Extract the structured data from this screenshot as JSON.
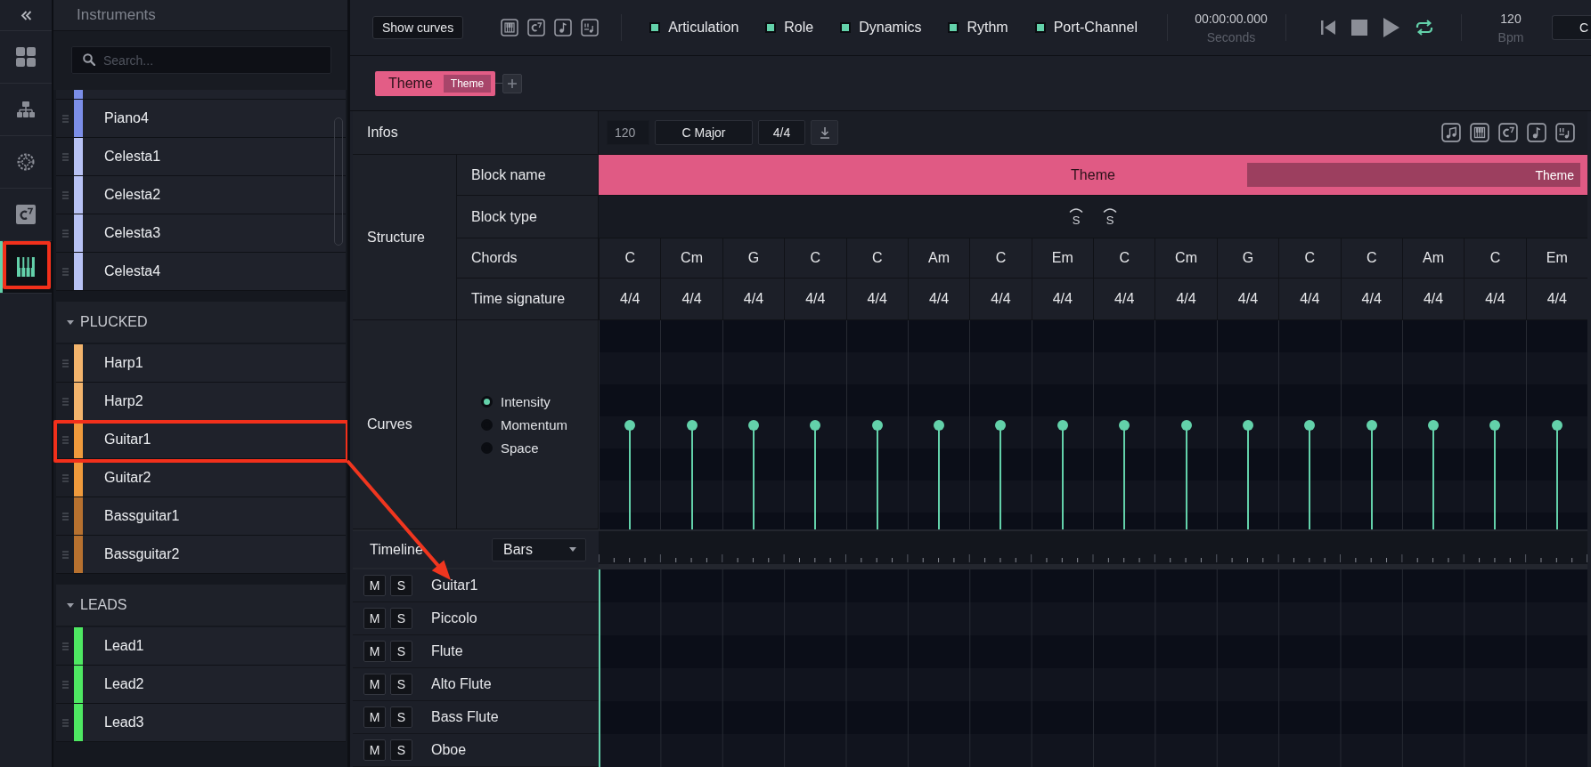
{
  "rail": {
    "items": [
      {
        "kind": "grid",
        "selected": false,
        "annotated": false
      },
      {
        "kind": "hierarchy",
        "selected": false,
        "annotated": false
      },
      {
        "kind": "wheel",
        "selected": false,
        "annotated": false
      },
      {
        "kind": "chord",
        "selected": false,
        "annotated": false
      },
      {
        "kind": "piano",
        "selected": true,
        "annotated": true
      }
    ]
  },
  "instruments": {
    "title": "Instruments",
    "search": {
      "placeholder": "Search..."
    },
    "groups": [
      {
        "items": [
          {
            "kind": "clipped",
            "color": "#7b8ee8",
            "annotated": false
          },
          {
            "kind": "row",
            "name": "Piano4",
            "color": "#7b8ee8",
            "annotated": false
          },
          {
            "kind": "row",
            "name": "Celesta1",
            "color": "#b8c2f4",
            "annotated": false
          },
          {
            "kind": "row",
            "name": "Celesta2",
            "color": "#b8c2f4",
            "annotated": false
          },
          {
            "kind": "row",
            "name": "Celesta3",
            "color": "#b8c2f4",
            "annotated": false
          },
          {
            "kind": "row",
            "name": "Celesta4",
            "color": "#b8c2f4",
            "annotated": false
          }
        ]
      },
      {
        "name": "PLUCKED",
        "expanded": true,
        "items": [
          {
            "kind": "row",
            "name": "Harp1",
            "color": "#f3b46c",
            "annotated": false
          },
          {
            "kind": "row",
            "name": "Harp2",
            "color": "#f3b46c",
            "annotated": false
          },
          {
            "kind": "row",
            "name": "Guitar1",
            "color": "#ef9a3c",
            "annotated": true
          },
          {
            "kind": "row",
            "name": "Guitar2",
            "color": "#ef9a3c",
            "annotated": false
          },
          {
            "kind": "row",
            "name": "Bassguitar1",
            "color": "#b7712f",
            "annotated": false
          },
          {
            "kind": "row",
            "name": "Bassguitar2",
            "color": "#b7712f",
            "annotated": false
          }
        ]
      },
      {
        "name": "LEADS",
        "expanded": true,
        "items": [
          {
            "kind": "row",
            "name": "Lead1",
            "color": "#4ee862",
            "annotated": false
          },
          {
            "kind": "row",
            "name": "Lead2",
            "color": "#4ee862",
            "annotated": false
          },
          {
            "kind": "row",
            "name": "Lead3",
            "color": "#4ee862",
            "annotated": false
          }
        ]
      }
    ]
  },
  "toolbar": {
    "show_curves": "Show curves",
    "views": [
      {
        "kind": "piano"
      },
      {
        "kind": "chord"
      },
      {
        "kind": "note"
      },
      {
        "kind": "score"
      }
    ],
    "legend": [
      {
        "label": "Articulation",
        "checked": true
      },
      {
        "label": "Role",
        "checked": true
      },
      {
        "label": "Dynamics",
        "checked": true
      },
      {
        "label": "Rythm",
        "checked": true
      },
      {
        "label": "Port-Channel",
        "checked": true
      }
    ],
    "time": {
      "value": "00:00:00.000",
      "unit": "Seconds"
    },
    "transport": [
      {
        "kind": "skip-back",
        "on": false
      },
      {
        "kind": "stop",
        "on": false
      },
      {
        "kind": "play",
        "on": false
      },
      {
        "kind": "loop",
        "on": true
      }
    ],
    "tempo": {
      "value": "120",
      "unit": "Bpm"
    },
    "clipped_field": "C"
  },
  "blocks": [
    {
      "label": "Theme",
      "part": "Theme",
      "selected": true
    }
  ],
  "editor": {
    "infos": {
      "label": "Infos",
      "tempo": "120",
      "key": "C Major",
      "time_signature": "4/4",
      "views": [
        {
          "kind": "music"
        },
        {
          "kind": "piano"
        },
        {
          "kind": "chord"
        },
        {
          "kind": "note"
        },
        {
          "kind": "score"
        }
      ]
    },
    "structure": {
      "label": "Structure",
      "block_name": {
        "label": "Block name",
        "block": "Theme",
        "part": "Theme"
      },
      "block_type": {
        "label": "Block type",
        "markers": [
          "S",
          "S"
        ]
      },
      "chords": {
        "label": "Chords",
        "values": [
          "C",
          "Cm",
          "G",
          "C",
          "C",
          "Am",
          "C",
          "Em",
          "C",
          "Cm",
          "G",
          "C",
          "C",
          "Am",
          "C",
          "Em"
        ]
      },
      "time_signature": {
        "label": "Time signature",
        "values": [
          "4/4",
          "4/4",
          "4/4",
          "4/4",
          "4/4",
          "4/4",
          "4/4",
          "4/4",
          "4/4",
          "4/4",
          "4/4",
          "4/4",
          "4/4",
          "4/4",
          "4/4",
          "4/4"
        ]
      }
    },
    "curves": {
      "label": "Curves",
      "options": [
        {
          "label": "Intensity",
          "selected": true
        },
        {
          "label": "Momentum",
          "selected": false
        },
        {
          "label": "Space",
          "selected": false
        }
      ]
    },
    "timeline": {
      "label": "Timeline",
      "unit": "Bars"
    },
    "tracks": [
      {
        "name": "Guitar1",
        "mute": "M",
        "solo": "S",
        "annotated": true
      },
      {
        "name": "Piccolo",
        "mute": "M",
        "solo": "S",
        "annotated": false
      },
      {
        "name": "Flute",
        "mute": "M",
        "solo": "S",
        "annotated": false
      },
      {
        "name": "Alto Flute",
        "mute": "M",
        "solo": "S",
        "annotated": false
      },
      {
        "name": "Bass Flute",
        "mute": "M",
        "solo": "S",
        "annotated": false
      },
      {
        "name": "Oboe",
        "mute": "M",
        "solo": "S",
        "annotated": false
      }
    ]
  }
}
